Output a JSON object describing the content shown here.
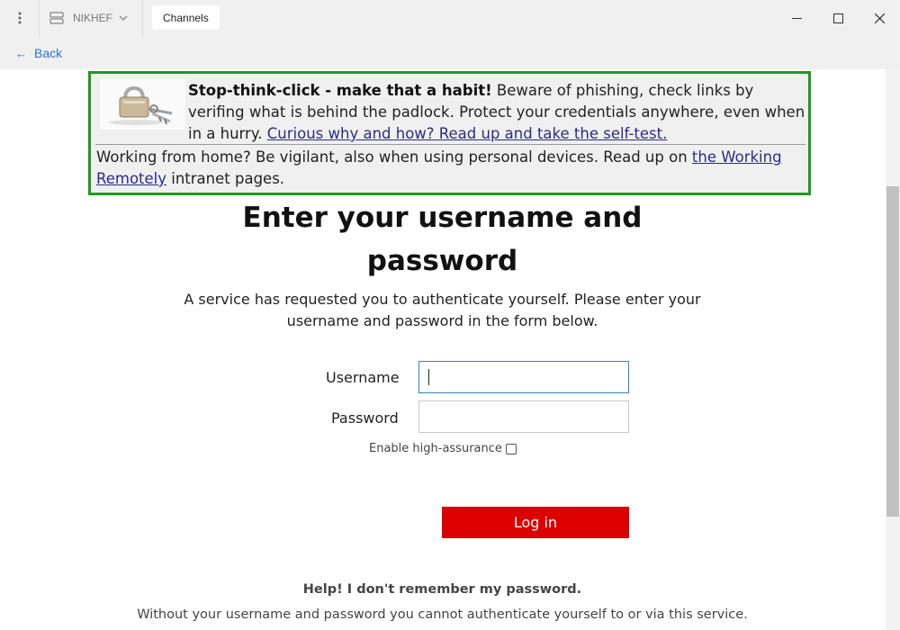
{
  "titlebar": {
    "workspace_label": "NIKHEF",
    "tab_label": "Channels",
    "icons": {
      "menu": "vertical-dots-icon",
      "workspace": "server-stack-icon",
      "chevron": "chevron-down-icon",
      "minimize": "minimize-icon",
      "maximize": "maximize-icon",
      "close": "close-icon"
    }
  },
  "nav": {
    "back_label": "Back",
    "back_icon": "arrow-left-icon",
    "accent_color": "#2f6fdc"
  },
  "notice": {
    "image": "padlock-keys-image",
    "heading": "Stop-think-click - make that a habit!",
    "body": " Beware of phishing, check links by verifing what is behind the padlock. Protect your credentials anywhere, even when in a hurry. ",
    "link1": "Curious why and how? Read up and take the self-test.",
    "remote_text": "Working from home? Be vigilant, also when using personal devices. Read up on ",
    "link2": "the Working Remotely",
    "remote_suffix": " intranet pages.",
    "border_color": "#1f9a1f"
  },
  "form": {
    "title": "Enter your username and password",
    "description": "A service has requested you to authenticate yourself. Please enter your username and password in the form below.",
    "username_label": "Username",
    "username_value": "",
    "password_label": "Password",
    "password_value": "",
    "high_assurance_label": "Enable high-assurance",
    "high_assurance_checked": false,
    "login_label": "Log in",
    "login_color": "#dd0000"
  },
  "help": {
    "title": "Help! I don't remember my password.",
    "text": "Without your username and password you cannot authenticate yourself to or via this service."
  }
}
